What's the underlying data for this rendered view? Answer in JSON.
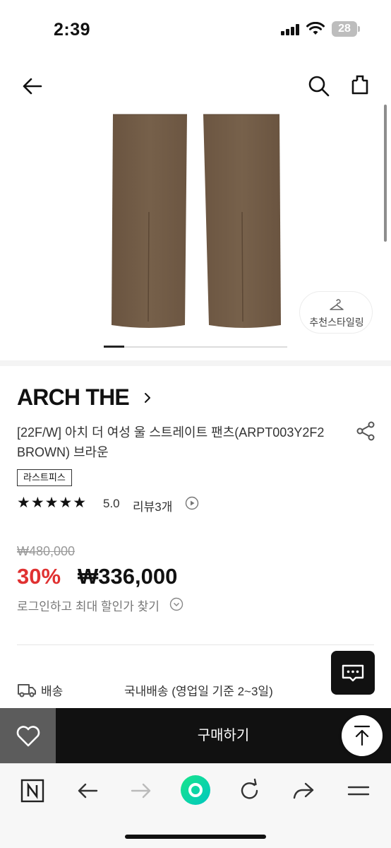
{
  "status_bar": {
    "time": "2:39",
    "battery": "28"
  },
  "product": {
    "brand": "ARCH THE",
    "name": "[22F/W] 아치 더 여성 울 스트레이트 팬츠(ARPT003Y2F2 BROWN) 브라운",
    "badge": "라스트피스",
    "stars": "★★★★★",
    "rating": "5.0",
    "reviews": "리뷰3개",
    "image_count_progress": 0.11,
    "styling_label": "추천스타일링"
  },
  "price": {
    "original": "₩480,000",
    "discount": "30%",
    "sale": "₩336,000",
    "login_discount": "로그인하고 최대 할인가 찾기"
  },
  "shipping": {
    "label": "배송",
    "value": "국내배송 (영업일 기준 2~3일)"
  },
  "buy_bar": {
    "buy_label": "구매하기"
  },
  "colors": {
    "accent_red": "#e03131",
    "buy_bar": "#111111",
    "wish_bg": "#5c5c5c",
    "fabric_brown": "#715c45"
  },
  "icons": [
    "back-icon",
    "search-icon",
    "share-icon",
    "chevron-right-icon",
    "hanger-icon",
    "play-icon",
    "chevron-down-icon",
    "truck-icon",
    "chat-icon",
    "heart-icon",
    "arrow-up-icon",
    "naver-n-icon",
    "refresh-icon",
    "forward-share-icon",
    "menu-icon"
  ]
}
